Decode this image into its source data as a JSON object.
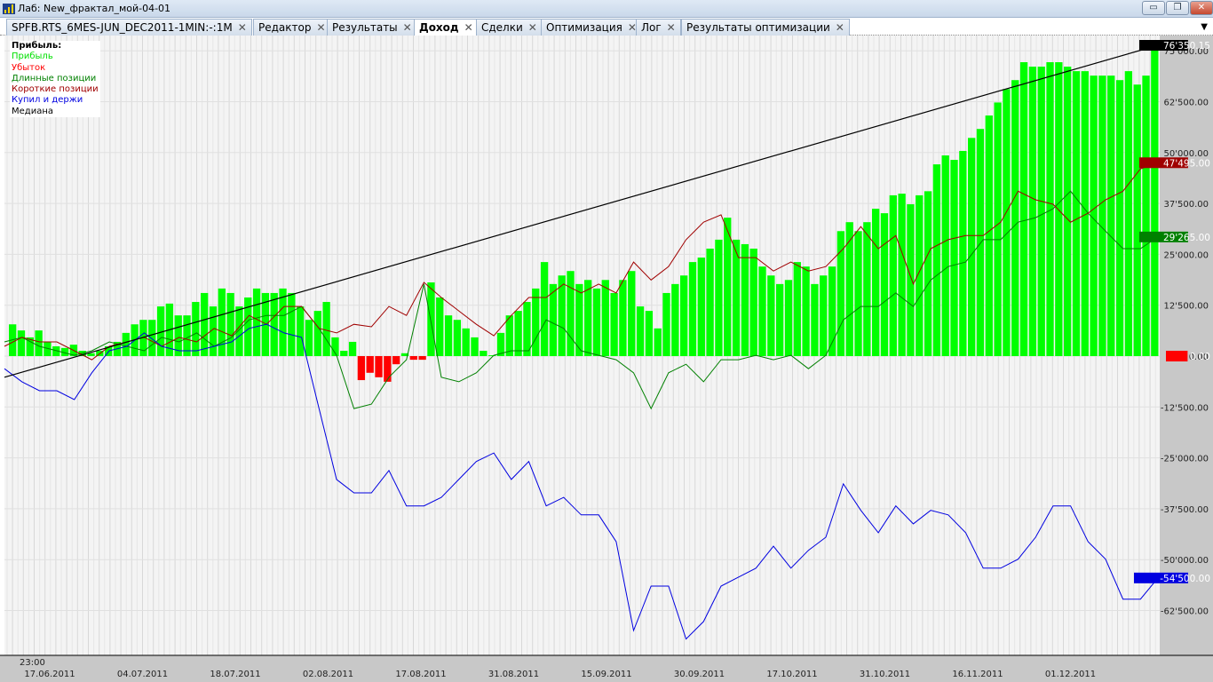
{
  "window": {
    "title": "Лаб: New_фрактал_мой-04-01",
    "minimize": "▭",
    "restore": "❐",
    "close": "✕"
  },
  "tabs": [
    {
      "label": "SPFB.RTS_6MES-JUN_DEC2011-1MIN:-:1M",
      "active": false
    },
    {
      "label": "Редактор",
      "active": false
    },
    {
      "label": "Результаты",
      "active": false
    },
    {
      "label": "Доход",
      "active": true
    },
    {
      "label": "Сделки",
      "active": false
    },
    {
      "label": "Оптимизация",
      "active": false
    },
    {
      "label": "Лог",
      "active": false
    },
    {
      "label": "Результаты оптимизации",
      "active": false
    }
  ],
  "tab_close": "✕",
  "legend": {
    "title": "Прибыль:",
    "items": [
      {
        "label": "Прибыль",
        "color": "#00e000"
      },
      {
        "label": "Убыток",
        "color": "#ff0000"
      },
      {
        "label": "Длинные позиции",
        "color": "#008000"
      },
      {
        "label": "Короткие позиции",
        "color": "#a00000"
      },
      {
        "label": "Купил и держи",
        "color": "#0000e0"
      },
      {
        "label": "Медиана",
        "color": "#000000"
      }
    ]
  },
  "chart_data": {
    "type": "bar",
    "units": "thousands",
    "ylim": [
      -75,
      80
    ],
    "yticks": [
      "75'000.00",
      "62'500.00",
      "50'000.00",
      "37'500.00",
      "25'000.00",
      "12'500.00",
      "0.00",
      "-12'500.00",
      "-25'000.00",
      "-37'500.00",
      "-50'000.00",
      "-62'500.00"
    ],
    "ytick_values": [
      75,
      62.5,
      50,
      37.5,
      25,
      12.5,
      0,
      -12.5,
      -25,
      -37.5,
      -50,
      -62.5
    ],
    "xtime": "23:00",
    "xticks": [
      "17.06.2011",
      "04.07.2011",
      "18.07.2011",
      "02.08.2011",
      "17.08.2011",
      "31.08.2011",
      "15.09.2011",
      "30.09.2011",
      "17.10.2011",
      "31.10.2011",
      "16.11.2011",
      "01.12.2011"
    ],
    "profit": [
      7.8,
      6.3,
      4.6,
      6.3,
      3.5,
      2.4,
      2.0,
      2.8,
      1.3,
      0.7,
      1.3,
      2.4,
      3.5,
      5.7,
      7.8,
      8.9,
      8.9,
      12.2,
      12.9,
      10.0,
      10.0,
      13.3,
      15.5,
      12.2,
      16.6,
      15.5,
      12.2,
      14.4,
      16.6,
      15.5,
      15.5,
      16.6,
      15.5,
      12.2,
      8.9,
      11.1,
      13.3,
      4.6,
      1.3,
      3.5,
      -5.9,
      -4.1,
      -5.2,
      -6.3,
      -2.0,
      0.7,
      -0.9,
      -0.9,
      18.1,
      14.4,
      10.0,
      8.9,
      6.8,
      4.6,
      1.3,
      0.2,
      5.7,
      10.0,
      11.1,
      13.3,
      16.6,
      23.1,
      17.7,
      19.8,
      20.9,
      17.7,
      18.7,
      16.6,
      18.7,
      15.5,
      18.7,
      20.9,
      12.2,
      11.1,
      6.8,
      15.5,
      17.7,
      19.8,
      23.1,
      24.2,
      26.4,
      28.6,
      34.0,
      28.6,
      27.5,
      26.4,
      22.0,
      19.8,
      17.7,
      18.7,
      23.1,
      22.0,
      17.7,
      19.8,
      22.0,
      30.7,
      32.9,
      30.7,
      32.9,
      36.2,
      35.1,
      39.5,
      39.9,
      37.3,
      39.5,
      40.5,
      47.1,
      49.3,
      48.2,
      50.4,
      53.6,
      55.8,
      59.1,
      62.3,
      65.6,
      67.8,
      72.2,
      71.1,
      71.1,
      72.2,
      72.2,
      71.1,
      70.0,
      70.0,
      68.9,
      68.9,
      68.9,
      67.8,
      70.0,
      66.7,
      68.9,
      76.35
    ],
    "short": [
      2.4,
      4.6,
      3.5,
      3.5,
      1.3,
      -0.9,
      2.4,
      3.5,
      4.6,
      2.4,
      4.6,
      3.5,
      6.8,
      5.0,
      10.0,
      7.8,
      12.2,
      12.2,
      6.8,
      5.7,
      7.8,
      7.2,
      12.2,
      10.0,
      18.1,
      14.4,
      11.1,
      7.8,
      5.0,
      10.0,
      14.4,
      14.4,
      17.7,
      15.5,
      17.7,
      15.5,
      23.1,
      18.7,
      22.0,
      28.6,
      32.9,
      34.7,
      24.2,
      24.2,
      20.9,
      23.1,
      20.9,
      22.0,
      26.4,
      31.8,
      26.4,
      29.6,
      17.7,
      26.4,
      28.6,
      29.6,
      29.6,
      32.9,
      40.5,
      38.4,
      37.3,
      32.9,
      35.1,
      38.4,
      40.5,
      46.0,
      47.5
    ],
    "long": [
      3.5,
      4.6,
      2.4,
      1.3,
      0.2,
      1.3,
      3.5,
      2.4,
      1.3,
      4.6,
      3.5,
      5.7,
      2.4,
      4.6,
      8.9,
      10.0,
      10.0,
      12.2,
      6.8,
      0.2,
      -12.9,
      -11.8,
      -5.2,
      -0.9,
      17.7,
      -5.2,
      -6.3,
      -4.1,
      0.2,
      1.3,
      1.3,
      8.9,
      6.8,
      1.3,
      0.2,
      -0.9,
      -4.1,
      -12.9,
      -4.1,
      -2.0,
      -6.3,
      -0.9,
      -0.9,
      0.2,
      -0.9,
      0.2,
      -3.1,
      0.2,
      8.9,
      12.2,
      12.2,
      15.5,
      12.2,
      18.7,
      22.0,
      23.1,
      28.6,
      28.6,
      32.9,
      34.0,
      36.2,
      40.5,
      35.1,
      30.7,
      26.4,
      26.4,
      29.3
    ],
    "buy_hold": [
      -3.1,
      -6.3,
      -8.5,
      -8.5,
      -10.7,
      -4.1,
      1.3,
      2.4,
      5.7,
      2.4,
      1.3,
      1.3,
      2.4,
      3.5,
      6.8,
      7.8,
      5.7,
      4.6,
      -12.9,
      -30.3,
      -33.6,
      -33.6,
      -28.1,
      -36.8,
      -36.8,
      -34.7,
      -30.3,
      -25.9,
      -23.8,
      -30.3,
      -25.9,
      -36.8,
      -34.7,
      -39.0,
      -39.0,
      -45.6,
      -67.4,
      -56.5,
      -56.5,
      -69.5,
      -65.2,
      -56.5,
      -54.3,
      -52.1,
      -46.7,
      -52.1,
      -47.7,
      -44.5,
      -31.4,
      -37.9,
      -43.4,
      -36.8,
      -41.2,
      -37.9,
      -39.0,
      -43.4,
      -52.1,
      -52.1,
      -49.9,
      -44.5,
      -36.8,
      -36.8,
      -45.6,
      -49.9,
      -59.7,
      -59.7,
      -54.5
    ],
    "median": [
      -5.2,
      76.35
    ],
    "last_labels": [
      {
        "text": "76'350.15",
        "value": 76.35,
        "bg": "#000000",
        "fg": "#ffffff"
      },
      {
        "text": "47'495.00",
        "value": 47.5,
        "bg": "#a00000",
        "fg": "#ffffff"
      },
      {
        "text": "29'265.00",
        "value": 29.27,
        "bg": "#008000",
        "fg": "#ffffff"
      },
      {
        "text": "0.00",
        "value": 0,
        "bg": "#ff0000",
        "fg": "#ffffff"
      },
      {
        "text": "-54'500.00",
        "value": -54.5,
        "bg": "#0000e0",
        "fg": "#ffffff"
      }
    ]
  }
}
